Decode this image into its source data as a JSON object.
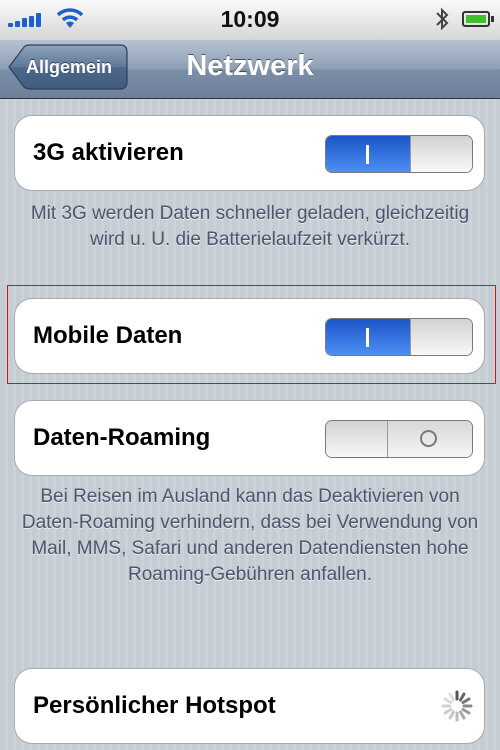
{
  "status_bar": {
    "time": "10:09",
    "signal_icon": "signal-bars-icon",
    "wifi_icon": "wifi-icon",
    "bluetooth_icon": "bluetooth-icon",
    "battery_icon": "battery-icon",
    "battery_level": 1.0,
    "battery_color": "#3ec22a"
  },
  "nav": {
    "back_label": "Allgemein",
    "title": "Netzwerk"
  },
  "settings": {
    "threeg": {
      "label": "3G aktivieren",
      "on": true
    },
    "threeg_note": "Mit 3G werden Daten schneller geladen, gleichzeitig wird u. U. die Batterielaufzeit verkürzt.",
    "mobile_data": {
      "label": "Mobile Daten",
      "on": true
    },
    "roaming": {
      "label": "Daten-Roaming",
      "on": false
    },
    "roaming_note": "Bei Reisen im Ausland kann das Deaktivieren von Daten-Roaming verhindern, dass bei Verwendung von Mail, MMS, Safari und anderen Datendiensten hohe Roaming-Gebühren anfallen.",
    "hotspot": {
      "label": "Persönlicher Hotspot",
      "status_icon": "loading-spinner-icon"
    }
  },
  "colors": {
    "toggle_on": "#1a55c8",
    "highlight": "#e01010"
  }
}
